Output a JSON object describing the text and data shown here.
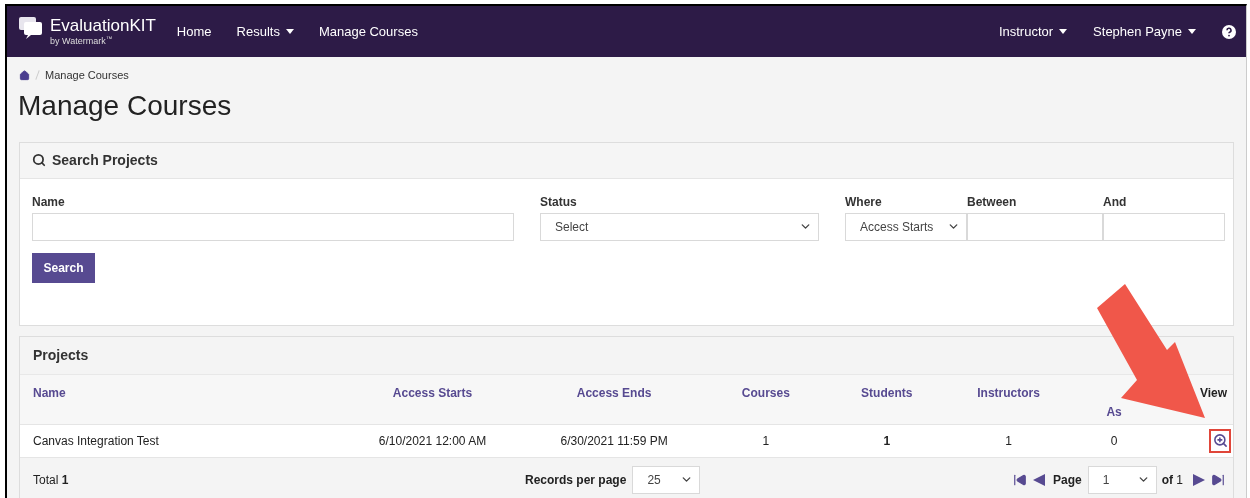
{
  "navbar": {
    "brand": "EvaluationKIT",
    "tagline": "by Watermark$^{™}$",
    "items": [
      {
        "label": "Home",
        "dropdown": false
      },
      {
        "label": "Results",
        "dropdown": true
      },
      {
        "label": "Manage Courses",
        "dropdown": false
      }
    ],
    "right_items": [
      {
        "label": "Instructor",
        "dropdown": true
      },
      {
        "label": "Stephen Payne",
        "dropdown": true
      }
    ]
  },
  "breadcrumb": [
    "Manage Courses"
  ],
  "title": "Manage Courses",
  "search_panel": {
    "title": "Search Projects",
    "fields": [
      {
        "kind": "text",
        "label": "Name"
      },
      {
        "kind": "select",
        "label": "Status",
        "value": "Select"
      },
      {
        "kind": "select",
        "label": "Where",
        "value": "Access Starts"
      },
      {
        "kind": "text",
        "label": "Between"
      },
      {
        "kind": "text",
        "label": "And"
      }
    ],
    "button": "Search"
  },
  "projects_panel": {
    "title": "Projects",
    "columns": [
      {
        "label": "Name",
        "sortable": true
      },
      {
        "label": "Access Starts",
        "sortable": true
      },
      {
        "label": "Access Ends",
        "sortable": true
      },
      {
        "label": "Courses",
        "sortable": true
      },
      {
        "label": "Students",
        "sortable": true
      },
      {
        "label": "Instructors",
        "sortable": true
      },
      {
        "label": "As",
        "sortable": true
      },
      {
        "label": "View",
        "sortable": false
      }
    ],
    "rows": [
      {
        "cells": [
          "Canvas Integration Test",
          "6/10/2021 12:00 AM",
          "6/30/2021 11:59 PM",
          "1",
          "1",
          "1",
          "0"
        ],
        "view_highlighted": true
      }
    ],
    "total": "Total **1**",
    "records_label": "Records per page",
    "records_value": "25",
    "page_label": "Page",
    "page_value": "1",
    "page_of": "**of** 1"
  }
}
